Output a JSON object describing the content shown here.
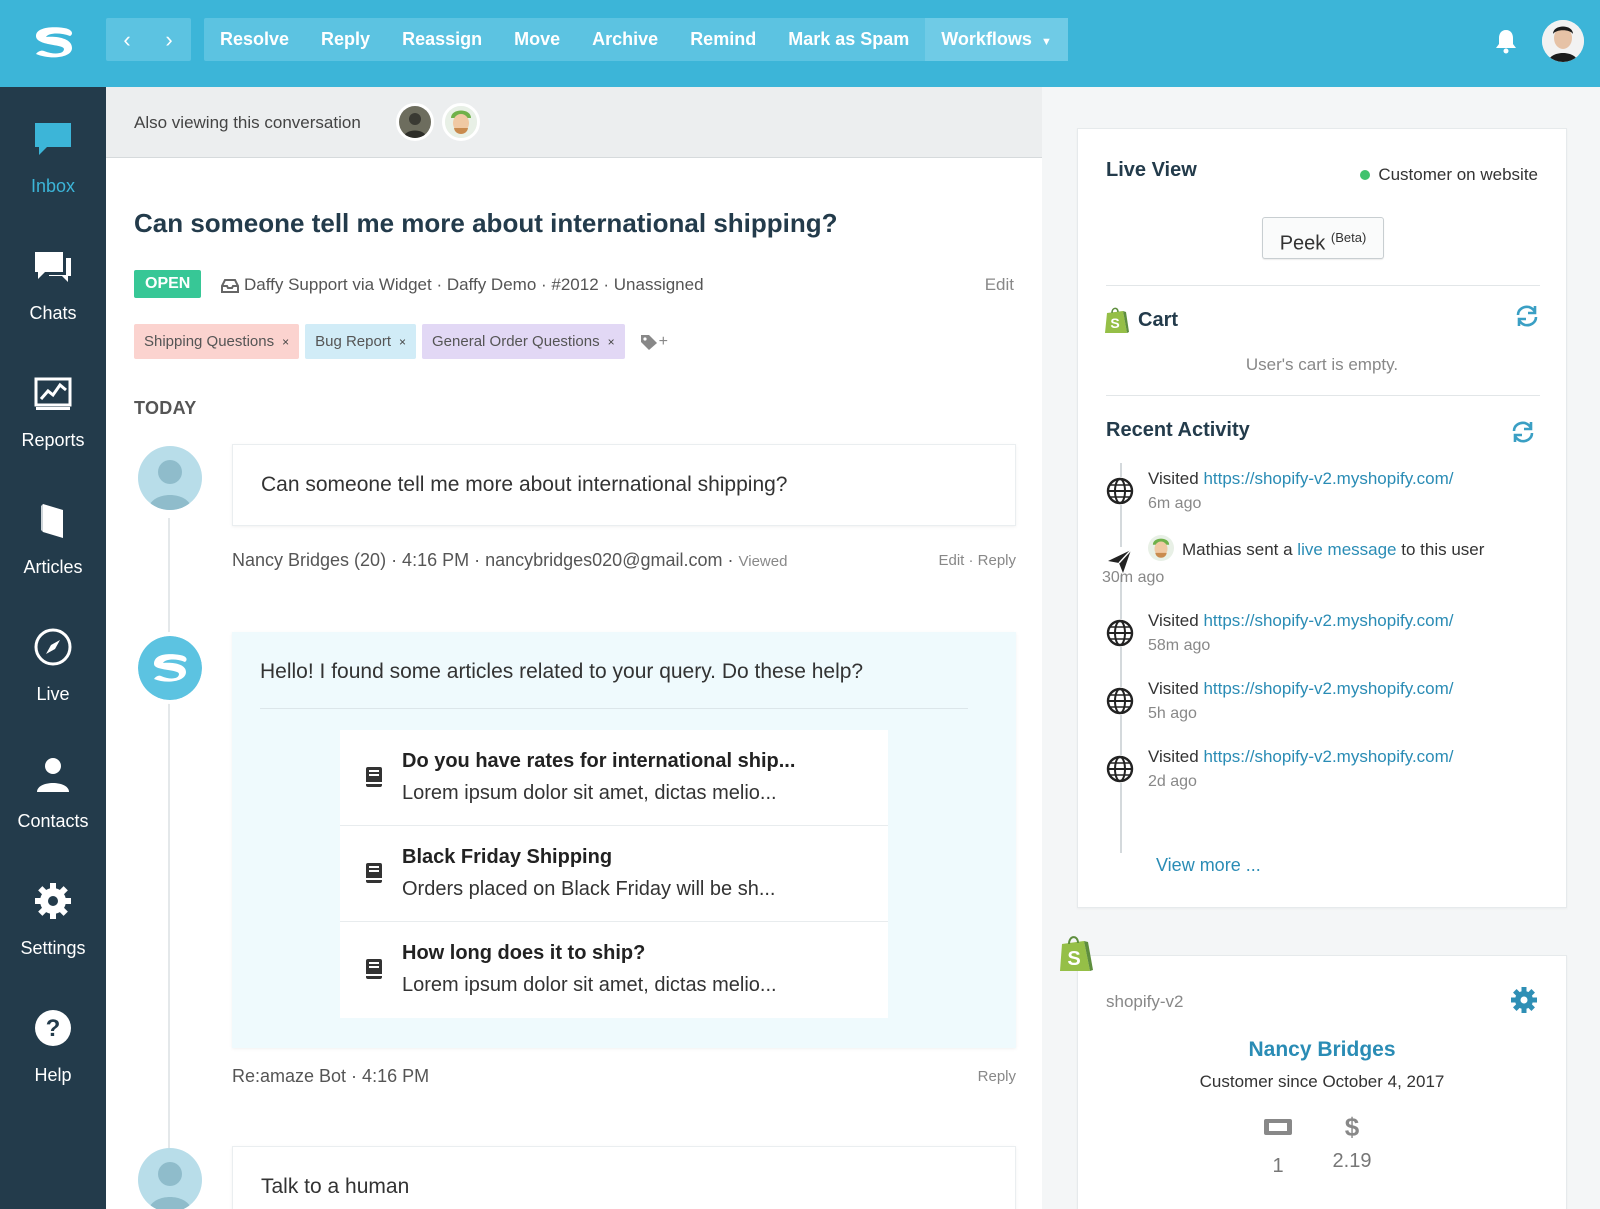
{
  "topbar": {
    "nav_prev": "‹",
    "nav_next": "›",
    "actions": [
      "Resolve",
      "Reply",
      "Reassign",
      "Move",
      "Archive",
      "Remind",
      "Mark as Spam"
    ],
    "workflows_label": "Workflows",
    "colors": {
      "bar": "#3cb5d8",
      "button_group": "#5cc3e1"
    }
  },
  "sidebar": {
    "items": [
      {
        "label": "Inbox",
        "icon": "inbox-chat-bubble-icon",
        "active": true
      },
      {
        "label": "Chats",
        "icon": "chats-icon"
      },
      {
        "label": "Reports",
        "icon": "reports-chart-icon"
      },
      {
        "label": "Articles",
        "icon": "articles-icon"
      },
      {
        "label": "Live",
        "icon": "compass-icon"
      },
      {
        "label": "Contacts",
        "icon": "contact-person-icon"
      },
      {
        "label": "Settings",
        "icon": "gear-icon"
      },
      {
        "label": "Help",
        "icon": "help-question-icon"
      }
    ],
    "colors": {
      "background": "#233b4b",
      "active": "#3cb5d8"
    }
  },
  "viewing": {
    "label": "Also viewing this conversation"
  },
  "conversation": {
    "title": "Can someone tell me more about international shipping?",
    "status": "OPEN",
    "meta": "Daffy Support via Widget · Daffy Demo · #2012 · Unassigned",
    "edit_label": "Edit",
    "tags": [
      "Shipping Questions",
      "Bug Report",
      "General Order Questions"
    ],
    "tag_close": "×",
    "tag_add": "+",
    "day_label": "TODAY",
    "messages": [
      {
        "text": "Can someone tell me more about international shipping?",
        "footer": "Nancy Bridges (20) · 4:16 PM · nancybridges020@gmail.com ·",
        "viewed": "Viewed",
        "footer_actions": "Edit  ·  Reply"
      },
      {
        "text": "Hello! I found some articles related to your query. Do these help?",
        "articles": [
          {
            "title": "Do you have rates for international ship...",
            "desc": "Lorem ipsum dolor sit amet, dictas melio..."
          },
          {
            "title": "Black Friday Shipping",
            "desc": "Orders placed on Black Friday will be sh..."
          },
          {
            "title": "How long does it to ship?",
            "desc": "Lorem ipsum dolor sit amet, dictas melio..."
          }
        ],
        "footer": "Re:amaze Bot · 4:16 PM",
        "footer_actions": "Reply"
      },
      {
        "text": "Talk to a human"
      }
    ]
  },
  "right_panel": {
    "live_view": {
      "title": "Live View",
      "status": "Customer on website",
      "peek_label": "Peek",
      "peek_sup": "(Beta)"
    },
    "cart": {
      "title": "Cart",
      "empty": "User's cart is empty."
    },
    "recent_activity": {
      "title": "Recent Activity",
      "items": [
        {
          "prefix": "Visited",
          "link": "https://shopify-v2.myshopify.com/",
          "time": "6m ago"
        },
        {
          "prefix": "Mathias sent a",
          "link": "live message",
          "suffix": "to this user",
          "time": "30m ago"
        },
        {
          "prefix": "Visited",
          "link": "https://shopify-v2.myshopify.com/",
          "time": "58m ago"
        },
        {
          "prefix": "Visited",
          "link": "https://shopify-v2.myshopify.com/",
          "time": "5h ago"
        },
        {
          "prefix": "Visited",
          "link": "https://shopify-v2.myshopify.com/",
          "time": "2d ago"
        }
      ],
      "view_more": "View more ..."
    },
    "shopify": {
      "store": "shopify-v2",
      "customer_name": "Nancy Bridges",
      "customer_since": "Customer since October 4, 2017",
      "orders": "1",
      "spent": "2.19",
      "spent_icon": "$"
    }
  }
}
